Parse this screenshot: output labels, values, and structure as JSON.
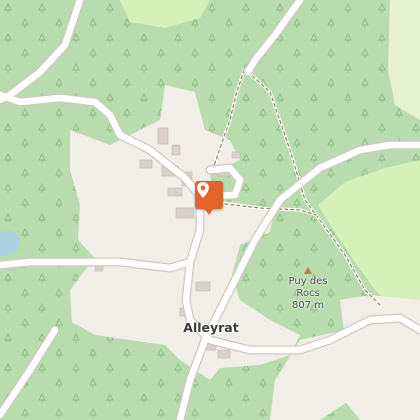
{
  "map": {
    "colors": {
      "forest": "#b9dcae",
      "field": "#f1eee8",
      "meadow": "#d5f0b8",
      "water": "#aad3df",
      "road": "#ffffff",
      "road_casing": "#cfc8c0",
      "building": "#d9d0c9",
      "path": "#8b8457",
      "tree_symbol": "#8fbf84",
      "marker": "#e5622a"
    },
    "labels": {
      "village": "Alleyrat",
      "peak_name": "Puy des Rocs",
      "peak_elevation": "807 m"
    },
    "marker": {
      "icon": "map-pin-icon",
      "color": "#e5622a"
    }
  }
}
